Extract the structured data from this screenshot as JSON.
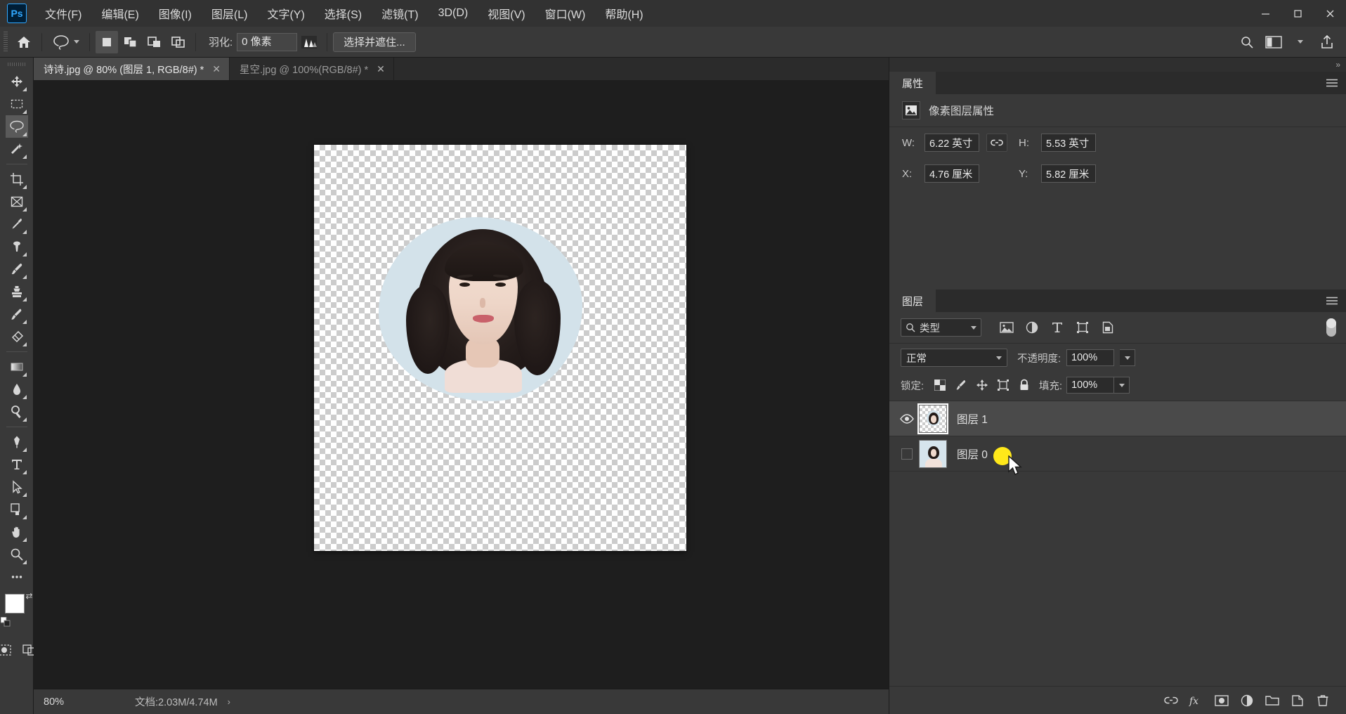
{
  "app": {
    "logo": "Ps",
    "window_controls": {
      "minimize": "—",
      "maximize": "▢",
      "close": "✕"
    }
  },
  "menubar": {
    "items": [
      {
        "label": "文件(F)"
      },
      {
        "label": "编辑(E)"
      },
      {
        "label": "图像(I)"
      },
      {
        "label": "图层(L)"
      },
      {
        "label": "文字(Y)"
      },
      {
        "label": "选择(S)"
      },
      {
        "label": "滤镜(T)"
      },
      {
        "label": "3D(D)"
      },
      {
        "label": "视图(V)"
      },
      {
        "label": "窗口(W)"
      },
      {
        "label": "帮助(H)"
      }
    ]
  },
  "options_bar": {
    "home_icon": "home-icon",
    "active_tool_icon": "lasso-icon",
    "selection_modes": [
      {
        "name": "new-selection",
        "active": true
      },
      {
        "name": "add-to-selection",
        "active": false
      },
      {
        "name": "subtract-from-selection",
        "active": false
      },
      {
        "name": "intersect-selection",
        "active": false
      }
    ],
    "feather_label": "羽化:",
    "feather_value": "0 像素",
    "antialias_icon": "antialias-icon",
    "select_and_mask_label": "选择并遮住...",
    "right_icons": [
      "search-icon",
      "workspace-icon",
      "chevron-down-icon",
      "share-icon"
    ]
  },
  "toolbar": {
    "tools": [
      {
        "name": "move-tool",
        "glyph": "move"
      },
      {
        "name": "marquee-tool",
        "glyph": "marquee"
      },
      {
        "name": "lasso-tool",
        "glyph": "lasso",
        "active": true
      },
      {
        "name": "quick-selection-tool",
        "glyph": "wand"
      },
      {
        "name": "crop-tool",
        "glyph": "crop"
      },
      {
        "name": "frame-tool",
        "glyph": "frame"
      },
      {
        "name": "eyedropper-tool",
        "glyph": "eyedropper"
      },
      {
        "name": "healing-brush-tool",
        "glyph": "healing"
      },
      {
        "name": "brush-tool",
        "glyph": "brush"
      },
      {
        "name": "clone-stamp-tool",
        "glyph": "stamp"
      },
      {
        "name": "history-brush-tool",
        "glyph": "history-brush"
      },
      {
        "name": "eraser-tool",
        "glyph": "eraser"
      },
      {
        "name": "gradient-tool",
        "glyph": "gradient"
      },
      {
        "name": "blur-tool",
        "glyph": "blur"
      },
      {
        "name": "dodge-tool",
        "glyph": "dodge"
      },
      {
        "name": "pen-tool",
        "glyph": "pen"
      },
      {
        "name": "type-tool",
        "glyph": "type"
      },
      {
        "name": "path-selection-tool",
        "glyph": "path-arrow"
      },
      {
        "name": "shape-tool",
        "glyph": "shape"
      },
      {
        "name": "hand-tool",
        "glyph": "hand"
      },
      {
        "name": "zoom-tool",
        "glyph": "zoom"
      },
      {
        "name": "more-tools",
        "glyph": "ellipsis"
      }
    ],
    "foreground_color": "#ffffff",
    "background_color": "#cfe0b4",
    "quick_mask_icon": "quick-mask-icon",
    "screen_mode_icon": "screen-mode-icon"
  },
  "tabs": [
    {
      "label": "诗诗.jpg @ 80% (图层 1, RGB/8#) *",
      "close": "✕",
      "active": true
    },
    {
      "label": "星空.jpg @ 100%(RGB/8#) *",
      "close": "✕",
      "active": false
    }
  ],
  "statusbar": {
    "zoom": "80%",
    "doc_info": "文档:2.03M/4.74M",
    "arrow": "›"
  },
  "properties_panel": {
    "tab_label": "属性",
    "menu_icon": "hamburger-icon",
    "header_icon": "pixel-layer-icon",
    "header_title": "像素图层属性",
    "fields": [
      {
        "label": "W:",
        "value": "6.22 英寸",
        "name": "width-field"
      },
      {
        "label": "H:",
        "value": "5.53 英寸",
        "name": "height-field"
      },
      {
        "label": "X:",
        "value": "4.76 厘米",
        "name": "x-field"
      },
      {
        "label": "Y:",
        "value": "5.82 厘米",
        "name": "y-field"
      }
    ],
    "link_icon": "link-icon"
  },
  "layers_panel": {
    "tab_label": "图层",
    "menu_icon": "hamburger-icon",
    "filter_label": "类型",
    "filter_icons": [
      "pixel-filter-icon",
      "adjustment-filter-icon",
      "type-filter-icon",
      "shape-filter-icon",
      "smart-object-filter-icon"
    ],
    "blend_mode": "正常",
    "opacity_label": "不透明度:",
    "opacity_value": "100%",
    "lock_label": "锁定:",
    "lock_icons": [
      "lock-transparency-icon",
      "lock-image-icon",
      "lock-position-icon",
      "lock-artboard-icon",
      "lock-all-icon"
    ],
    "fill_label": "填充:",
    "fill_value": "100%",
    "layers": [
      {
        "name": "图层 1",
        "visible": true,
        "selected": true,
        "transparent_thumb": true
      },
      {
        "name": "图层 0",
        "visible": false,
        "selected": false,
        "transparent_thumb": false
      }
    ],
    "footer_icons": [
      "link-layers-icon",
      "layer-style-icon",
      "layer-mask-icon",
      "adjustment-layer-icon",
      "new-group-icon",
      "new-layer-icon",
      "delete-layer-icon"
    ]
  },
  "collapse": {
    "label": "»"
  },
  "cursor": {
    "highlight_color": "#ffe81a"
  }
}
